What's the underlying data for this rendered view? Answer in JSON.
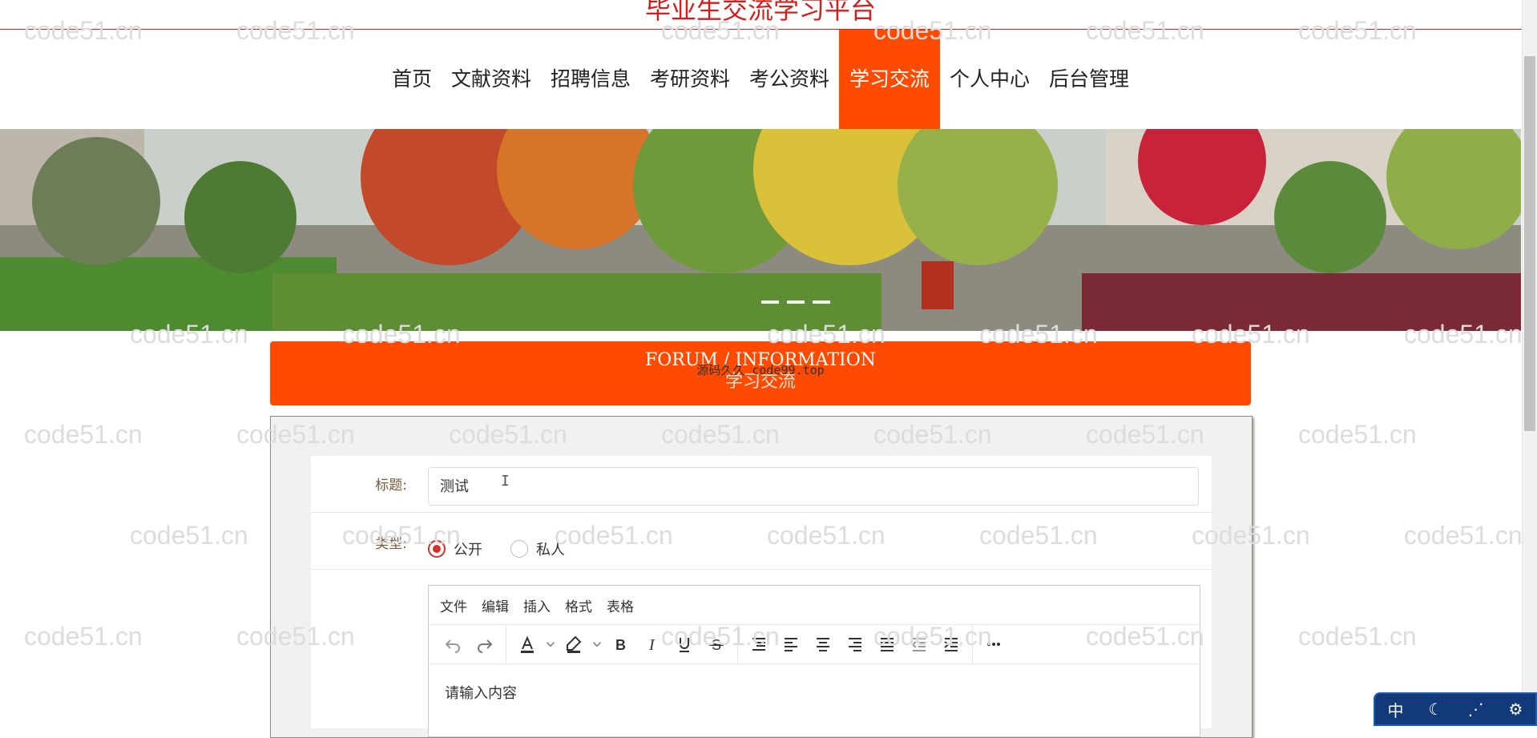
{
  "site": {
    "title": "毕业生交流学习平台"
  },
  "nav": {
    "items": [
      {
        "label": "首页"
      },
      {
        "label": "文献资料"
      },
      {
        "label": "招聘信息"
      },
      {
        "label": "考研资料"
      },
      {
        "label": "考公资料"
      },
      {
        "label": "学习交流",
        "active": true
      },
      {
        "label": "个人中心"
      },
      {
        "label": "后台管理"
      }
    ]
  },
  "banner": {
    "slides": 3,
    "active_slide": 1
  },
  "section": {
    "title_en": "FORUM / INFORMATION",
    "title_cn": "学习交流"
  },
  "overlay": {
    "text": "源码久久 code99.top"
  },
  "watermark": {
    "text": "code51.cn"
  },
  "form": {
    "title_label": "标题:",
    "title_value": "测试",
    "type_label": "类型:",
    "type_options": [
      {
        "label": "公开",
        "checked": true
      },
      {
        "label": "私人",
        "checked": false
      }
    ]
  },
  "editor": {
    "menu": [
      "文件",
      "编辑",
      "插入",
      "格式",
      "表格"
    ],
    "toolbar": [
      "undo-icon",
      "redo-icon",
      "text-color-icon",
      "highlight-icon",
      "bold-icon",
      "italic-icon",
      "underline-icon",
      "strikethrough-icon",
      "line-height-icon",
      "align-left-icon",
      "align-center-icon",
      "align-right-icon",
      "align-justify-icon",
      "outdent-icon",
      "indent-icon",
      "more-icon"
    ],
    "placeholder": "请输入内容"
  },
  "ime": {
    "labels": [
      "中",
      "☾",
      "⋰",
      "⚙"
    ]
  },
  "colors": {
    "accent": "#ff4a00",
    "title_red": "#d41e1e",
    "radio_red": "#d32f2f"
  }
}
